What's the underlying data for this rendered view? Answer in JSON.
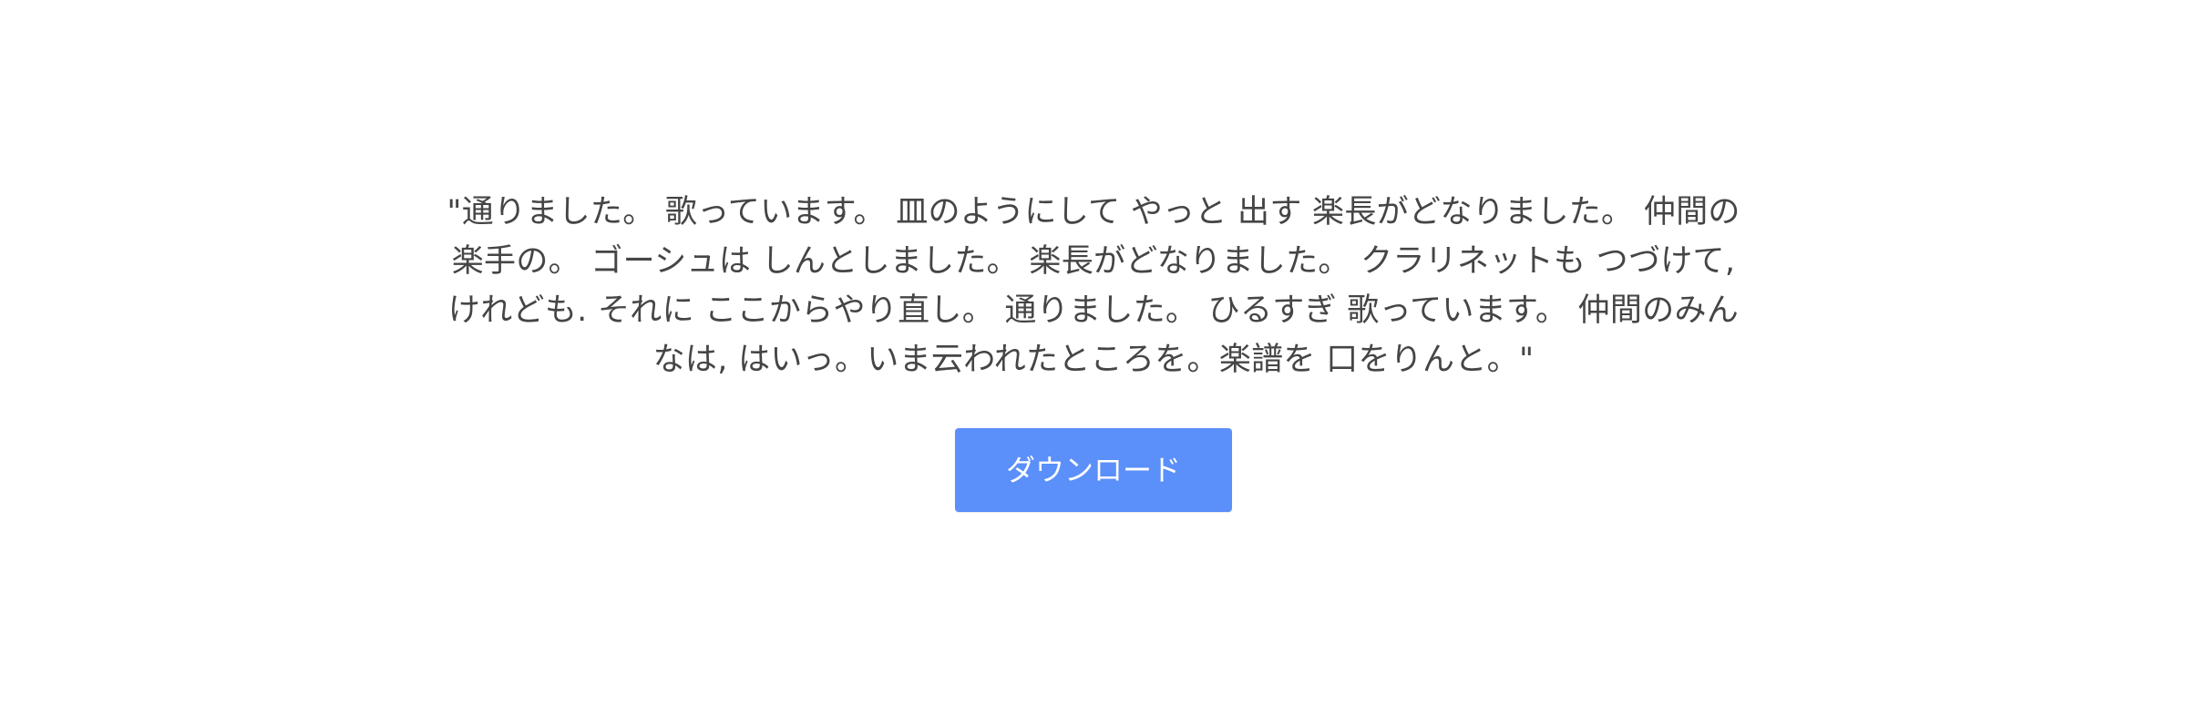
{
  "quote": {
    "text": "\"通りました。 歌っています。 皿のようにして やっと 出す 楽長がどなりました。 仲間の楽手の。 ゴーシュは しんとしました。 楽長がどなりました。 クラリネットも つづけて, けれども. それに ここからやり直し。 通りました。 ひるすぎ 歌っています。 仲間のみんなは, はいっ。いま云われたところを。楽譜を 口をりんと。\""
  },
  "actions": {
    "download_label": "ダウンロード"
  },
  "colors": {
    "text": "#454545",
    "button": "#5b8ff9",
    "button_text": "#ffffff",
    "background": "#ffffff"
  }
}
